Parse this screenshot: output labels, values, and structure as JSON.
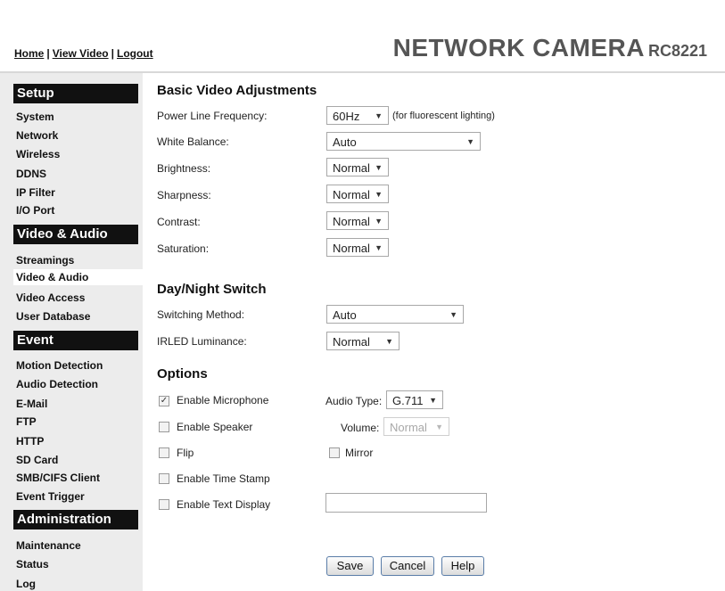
{
  "header": {
    "nav": [
      "Home",
      "View Video",
      "Logout"
    ],
    "brand": "NETWORK CAMERA",
    "model": "RC8221"
  },
  "sidebar": {
    "setup": {
      "title": "Setup",
      "items": [
        "System",
        "Network",
        "Wireless",
        "DDNS",
        "IP Filter",
        "I/O Port"
      ]
    },
    "video_audio": {
      "title": "Video & Audio",
      "items": [
        "Streamings",
        "Video & Audio",
        "Video Access",
        "User Database"
      ]
    },
    "event": {
      "title": "Event",
      "items": [
        "Motion Detection",
        "Audio Detection",
        "E-Mail",
        "FTP",
        "HTTP",
        "SD Card",
        "SMB/CIFS Client",
        "Event Trigger"
      ]
    },
    "administration": {
      "title": "Administration",
      "items": [
        "Maintenance",
        "Status",
        "Log"
      ]
    }
  },
  "basic": {
    "title": "Basic Video Adjustments",
    "power_line_label": "Power Line Frequency:",
    "power_line_value": "60Hz",
    "power_line_note": "(for fluorescent lighting)",
    "white_balance_label": "White Balance:",
    "white_balance_value": "Auto",
    "brightness_label": "Brightness:",
    "brightness_value": "Normal",
    "sharpness_label": "Sharpness:",
    "sharpness_value": "Normal",
    "contrast_label": "Contrast:",
    "contrast_value": "Normal",
    "saturation_label": "Saturation:",
    "saturation_value": "Normal"
  },
  "daynight": {
    "title": "Day/Night Switch",
    "method_label": "Switching Method:",
    "method_value": "Auto",
    "irled_label": "IRLED Luminance:",
    "irled_value": "Normal"
  },
  "options": {
    "title": "Options",
    "enable_mic": "Enable Microphone",
    "enable_mic_checked": true,
    "audio_type_label": "Audio Type:",
    "audio_type_value": "G.711",
    "enable_speaker": "Enable Speaker",
    "volume_label": "Volume:",
    "volume_value": "Normal",
    "flip": "Flip",
    "mirror": "Mirror",
    "time_stamp": "Enable Time Stamp",
    "text_display": "Enable Text Display",
    "text_display_value": ""
  },
  "buttons": {
    "save": "Save",
    "cancel": "Cancel",
    "help": "Help"
  },
  "icons": {
    "dropdown": "▼",
    "check": "✓"
  }
}
